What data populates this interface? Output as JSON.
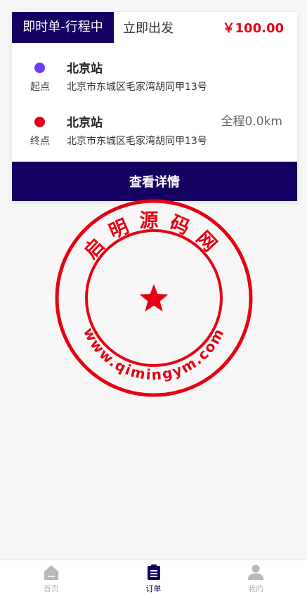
{
  "order": {
    "status_tag": "即时单-行程中",
    "depart_label": "立即出发",
    "price": "￥100.00",
    "start": {
      "label": "起点",
      "station": "北京站",
      "address": "北京市东城区毛家湾胡同甲13号"
    },
    "end": {
      "label": "终点",
      "station": "北京站",
      "address": "北京市东城区毛家湾胡同甲13号",
      "distance": "全程0.0km"
    },
    "detail_button": "查看详情"
  },
  "watermark": {
    "top_text": "启明源码网",
    "bottom_text": "www.qimingym.com"
  },
  "tabbar": {
    "items": [
      {
        "label": "首页",
        "icon": "home-icon",
        "active": false
      },
      {
        "label": "订单",
        "icon": "order-icon",
        "active": true
      },
      {
        "label": "我的",
        "icon": "user-icon",
        "active": false
      }
    ]
  },
  "colors": {
    "primary": "#150061",
    "price": "#e60012",
    "start_dot": "#6b3df2",
    "end_dot": "#e60012",
    "seal": "#e60012",
    "tab_inactive": "#b8b8b8"
  }
}
